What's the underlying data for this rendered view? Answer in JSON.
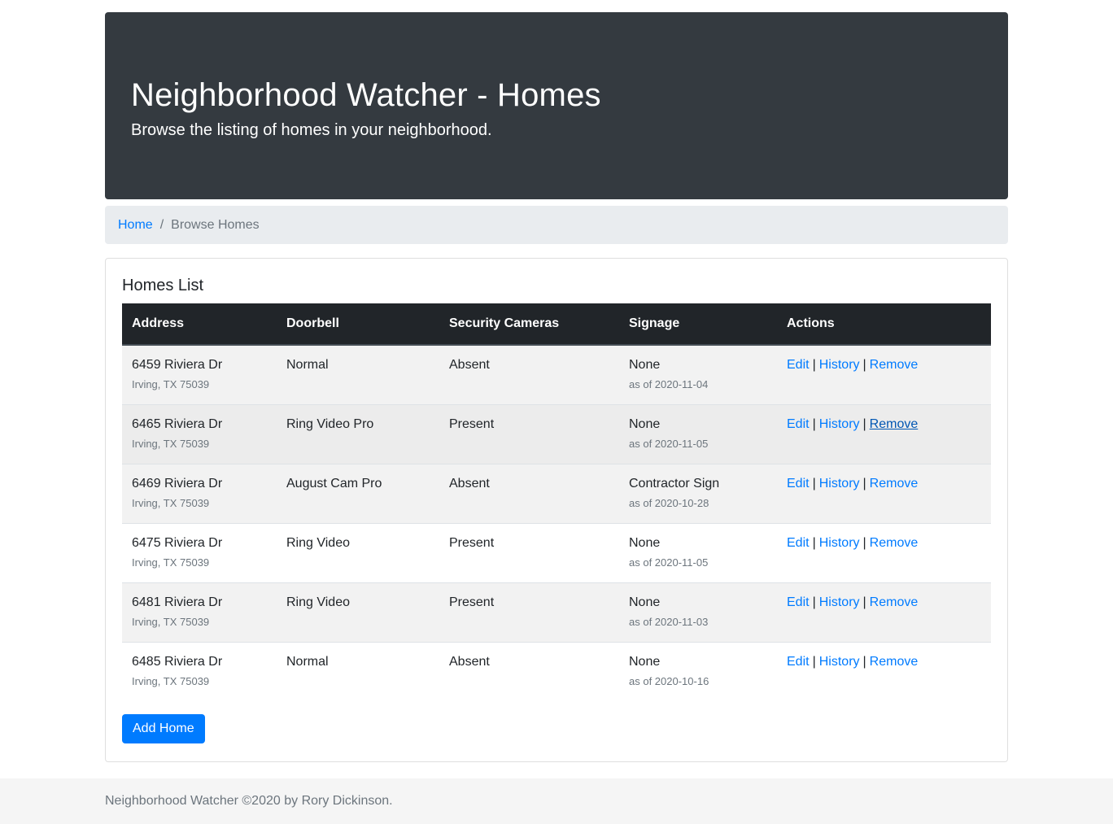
{
  "header": {
    "title": "Neighborhood Watcher - Homes",
    "subtitle": "Browse the listing of homes in your neighborhood."
  },
  "breadcrumb": {
    "home": "Home",
    "separator": "/",
    "current": "Browse Homes"
  },
  "card": {
    "title": "Homes List",
    "columns": [
      "Address",
      "Doorbell",
      "Security Cameras",
      "Signage",
      "Actions"
    ],
    "rows": [
      {
        "address": "6459 Riviera Dr",
        "city": "Irving, TX 75039",
        "doorbell": "Normal",
        "cameras": "Absent",
        "signage": "None",
        "as_of": "as of 2020-11-04"
      },
      {
        "address": "6465 Riviera Dr",
        "city": "Irving, TX 75039",
        "doorbell": "Ring Video Pro",
        "cameras": "Present",
        "signage": "None",
        "as_of": "as of 2020-11-05"
      },
      {
        "address": "6469 Riviera Dr",
        "city": "Irving, TX 75039",
        "doorbell": "August Cam Pro",
        "cameras": "Absent",
        "signage": "Contractor Sign",
        "as_of": "as of 2020-10-28"
      },
      {
        "address": "6475 Riviera Dr",
        "city": "Irving, TX 75039",
        "doorbell": "Ring Video",
        "cameras": "Present",
        "signage": "None",
        "as_of": "as of 2020-11-05"
      },
      {
        "address": "6481 Riviera Dr",
        "city": "Irving, TX 75039",
        "doorbell": "Ring Video",
        "cameras": "Present",
        "signage": "None",
        "as_of": "as of 2020-11-03"
      },
      {
        "address": "6485 Riviera Dr",
        "city": "Irving, TX 75039",
        "doorbell": "Normal",
        "cameras": "Absent",
        "signage": "None",
        "as_of": "as of 2020-10-16"
      }
    ],
    "actions": {
      "edit": "Edit",
      "history": "History",
      "remove": "Remove",
      "separator": "|"
    },
    "add_button": "Add Home"
  },
  "footer": {
    "text": "Neighborhood Watcher ©2020 by Rory Dickinson."
  },
  "colors": {
    "header_bg": "#343a40",
    "link": "#007bff",
    "table_head_bg": "#212529",
    "breadcrumb_bg": "#e9ecef",
    "footer_bg": "#f5f5f5"
  }
}
